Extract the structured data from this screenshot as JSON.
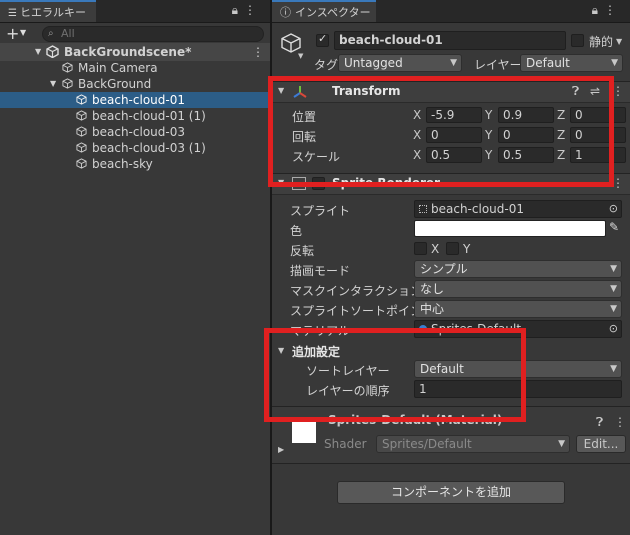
{
  "hierarchy": {
    "tab_label": "ヒエラルキー",
    "search_placeholder": "All",
    "scene_name": "BackGroundscene*",
    "items": [
      {
        "label": "Main Camera"
      },
      {
        "label": "BackGround"
      },
      {
        "label": "beach-cloud-01"
      },
      {
        "label": "beach-cloud-01 (1)"
      },
      {
        "label": "beach-cloud-03"
      },
      {
        "label": "beach-cloud-03 (1)"
      },
      {
        "label": "beach-sky"
      }
    ]
  },
  "inspector": {
    "tab_label": "インスペクター",
    "object_name": "beach-cloud-01",
    "static_label": "静的",
    "tag_label": "タグ",
    "tag_value": "Untagged",
    "layer_label": "レイヤー",
    "layer_value": "Default",
    "transform": {
      "title": "Transform",
      "position_label": "位置",
      "rotation_label": "回転",
      "scale_label": "スケール",
      "axis_x": "X",
      "axis_y": "Y",
      "axis_z": "Z",
      "position": {
        "x": "-5.9",
        "y": "0.9",
        "z": "0"
      },
      "rotation": {
        "x": "0",
        "y": "0",
        "z": "0"
      },
      "scale": {
        "x": "0.5",
        "y": "0.5",
        "z": "1"
      }
    },
    "sprite_renderer": {
      "title": "Sprite Renderer",
      "sprite_label": "スプライト",
      "sprite_value": "beach-cloud-01",
      "color_label": "色",
      "flip_label": "反転",
      "flip_x": "X",
      "flip_y": "Y",
      "draw_mode_label": "描画モード",
      "draw_mode_value": "シンプル",
      "mask_label": "マスクインタラクション",
      "mask_value": "なし",
      "sort_point_label": "スプライトソートポイント",
      "sort_point_value": "中心",
      "material_label": "マテリアル",
      "material_value": "Sprites-Default"
    },
    "additional": {
      "title": "追加設定",
      "sorting_layer_label": "ソートレイヤー",
      "sorting_layer_value": "Default",
      "order_label": "レイヤーの順序",
      "order_value": "1"
    },
    "material": {
      "title": "Sprites-Default (Material)",
      "shader_label": "Shader",
      "shader_value": "Sprites/Default",
      "edit_label": "Edit..."
    },
    "add_component_label": "コンポーネントを追加"
  }
}
